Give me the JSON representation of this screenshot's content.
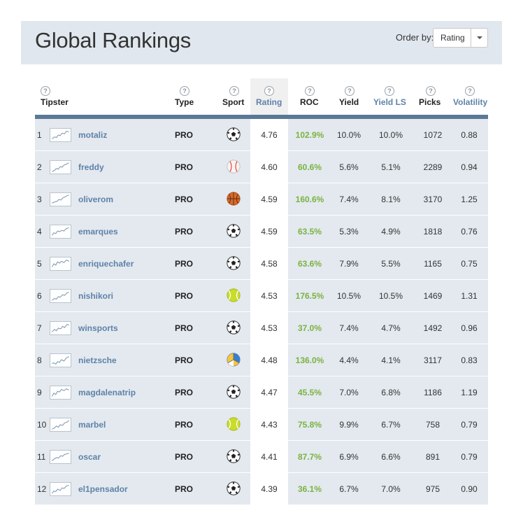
{
  "header": {
    "title": "Global Rankings",
    "order_label": "Order by:",
    "order_value": "Rating"
  },
  "columns": {
    "tipster": "Tipster",
    "type": "Type",
    "sport": "Sport",
    "rating": "Rating",
    "roc": "ROC",
    "yield": "Yield",
    "yield_ls": "Yield LS",
    "picks": "Picks",
    "volatility": "Volatility",
    "help": "?"
  },
  "colors": {
    "accent_link": "#5f82a8",
    "roc_green": "#7bb241",
    "header_bar": "#5b7896",
    "row_bg": "#e3e9ef"
  },
  "rows": [
    {
      "rank": "1",
      "name": "motaliz",
      "type": "PRO",
      "sport": "soccer-ball-icon",
      "rating": "4.76",
      "roc": "102.9%",
      "yield": "10.0%",
      "yield_ls": "10.0%",
      "picks": "1072",
      "volatility": "0.88"
    },
    {
      "rank": "2",
      "name": "freddy",
      "type": "PRO",
      "sport": "baseball-icon",
      "rating": "4.60",
      "roc": "60.6%",
      "yield": "5.6%",
      "yield_ls": "5.1%",
      "picks": "2289",
      "volatility": "0.94"
    },
    {
      "rank": "3",
      "name": "oliverom",
      "type": "PRO",
      "sport": "basketball-icon",
      "rating": "4.59",
      "roc": "160.6%",
      "yield": "7.4%",
      "yield_ls": "8.1%",
      "picks": "3170",
      "volatility": "1.25"
    },
    {
      "rank": "4",
      "name": "emarques",
      "type": "PRO",
      "sport": "soccer-ball-icon",
      "rating": "4.59",
      "roc": "63.5%",
      "yield": "5.3%",
      "yield_ls": "4.9%",
      "picks": "1818",
      "volatility": "0.76"
    },
    {
      "rank": "5",
      "name": "enriquechafer",
      "type": "PRO",
      "sport": "soccer-ball-icon",
      "rating": "4.58",
      "roc": "63.6%",
      "yield": "7.9%",
      "yield_ls": "5.5%",
      "picks": "1165",
      "volatility": "0.75"
    },
    {
      "rank": "6",
      "name": "nishikori",
      "type": "PRO",
      "sport": "tennis-ball-icon",
      "rating": "4.53",
      "roc": "176.5%",
      "yield": "10.5%",
      "yield_ls": "10.5%",
      "picks": "1469",
      "volatility": "1.31"
    },
    {
      "rank": "7",
      "name": "winsports",
      "type": "PRO",
      "sport": "soccer-ball-icon",
      "rating": "4.53",
      "roc": "37.0%",
      "yield": "7.4%",
      "yield_ls": "4.7%",
      "picks": "1492",
      "volatility": "0.96"
    },
    {
      "rank": "8",
      "name": "nietzsche",
      "type": "PRO",
      "sport": "volleyball-icon",
      "rating": "4.48",
      "roc": "136.0%",
      "yield": "4.4%",
      "yield_ls": "4.1%",
      "picks": "3117",
      "volatility": "0.83"
    },
    {
      "rank": "9",
      "name": "magdalenatrip",
      "type": "PRO",
      "sport": "soccer-ball-icon",
      "rating": "4.47",
      "roc": "45.5%",
      "yield": "7.0%",
      "yield_ls": "6.8%",
      "picks": "1186",
      "volatility": "1.19"
    },
    {
      "rank": "10",
      "name": "marbel",
      "type": "PRO",
      "sport": "tennis-ball-icon",
      "rating": "4.43",
      "roc": "75.8%",
      "yield": "9.9%",
      "yield_ls": "6.7%",
      "picks": "758",
      "volatility": "0.79"
    },
    {
      "rank": "11",
      "name": "oscar",
      "type": "PRO",
      "sport": "soccer-ball-icon",
      "rating": "4.41",
      "roc": "87.7%",
      "yield": "6.9%",
      "yield_ls": "6.6%",
      "picks": "891",
      "volatility": "0.79"
    },
    {
      "rank": "12",
      "name": "el1pensador",
      "type": "PRO",
      "sport": "soccer-ball-icon",
      "rating": "4.39",
      "roc": "36.1%",
      "yield": "6.7%",
      "yield_ls": "7.0%",
      "picks": "975",
      "volatility": "0.90"
    }
  ]
}
